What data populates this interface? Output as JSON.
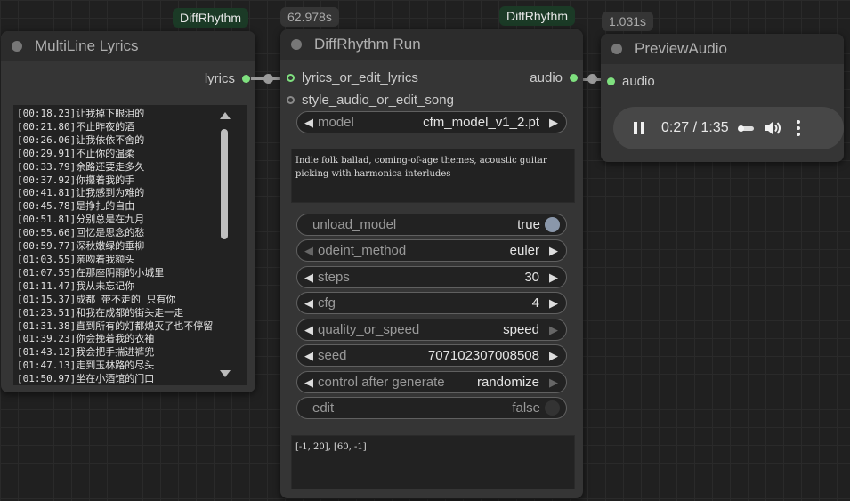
{
  "badges": {
    "multiline_group": "DiffRhythm",
    "run_time": "62.978s",
    "run_group": "DiffRhythm",
    "preview_time": "1.031s"
  },
  "multiline": {
    "title": "MultiLine Lyrics",
    "output_label": "lyrics",
    "lines": [
      "[00:18.23]让我掉下眼泪的",
      "[00:21.80]不止昨夜的酒",
      "[00:26.06]让我依依不舍的",
      "[00:29.91]不止你的温柔",
      "[00:33.79]余路还要走多久",
      "[00:37.92]你攥着我的手",
      "[00:41.81]让我感到为难的",
      "[00:45.78]是挣扎的自由",
      "[00:51.81]分别总是在九月",
      "[00:55.66]回忆是思念的愁",
      "[00:59.77]深秋嫩绿的垂柳",
      "[01:03.55]亲吻着我额头",
      "[01:07.55]在那座阴雨的小城里",
      "[01:11.47]我从未忘记你",
      "[01:15.37]成都 带不走的 只有你",
      "[01:23.51]和我在成都的街头走一走",
      "[01:31.38]直到所有的灯都熄灭了也不停留",
      "[01:39.23]你会挽着我的衣袖",
      "[01:43.12]我会把手揣进裤兜",
      "[01:47.13]走到玉林路的尽头",
      "[01:50.97]坐在小酒馆的门口"
    ]
  },
  "run": {
    "title": "DiffRhythm Run",
    "input_lyrics": "lyrics_or_edit_lyrics",
    "input_style": "style_audio_or_edit_song",
    "output_audio": "audio",
    "model": {
      "label": "model",
      "value": "cfm_model_v1_2.pt"
    },
    "prompt_text": "Indie folk ballad, coming-of-age themes, acoustic guitar picking with harmonica interludes",
    "unload_model": {
      "label": "unload_model",
      "value": "true"
    },
    "odeint_method": {
      "label": "odeint_method",
      "value": "euler"
    },
    "steps": {
      "label": "steps",
      "value": "30"
    },
    "cfg": {
      "label": "cfg",
      "value": "4"
    },
    "quality_or_speed": {
      "label": "quality_or_speed",
      "value": "speed"
    },
    "seed": {
      "label": "seed",
      "value": "707102307008508"
    },
    "control_after_generate": {
      "label": "control after generate",
      "value": "randomize"
    },
    "edit": {
      "label": "edit",
      "value": "false"
    },
    "edit_segments": "[-1, 20], [60, -1]"
  },
  "preview": {
    "title": "PreviewAudio",
    "input_audio": "audio",
    "time": "0:27 / 1:35"
  },
  "colors": {
    "slot_connected": "#7fe07f",
    "group_badge": "#1b3a26",
    "node_body": "#353535"
  }
}
